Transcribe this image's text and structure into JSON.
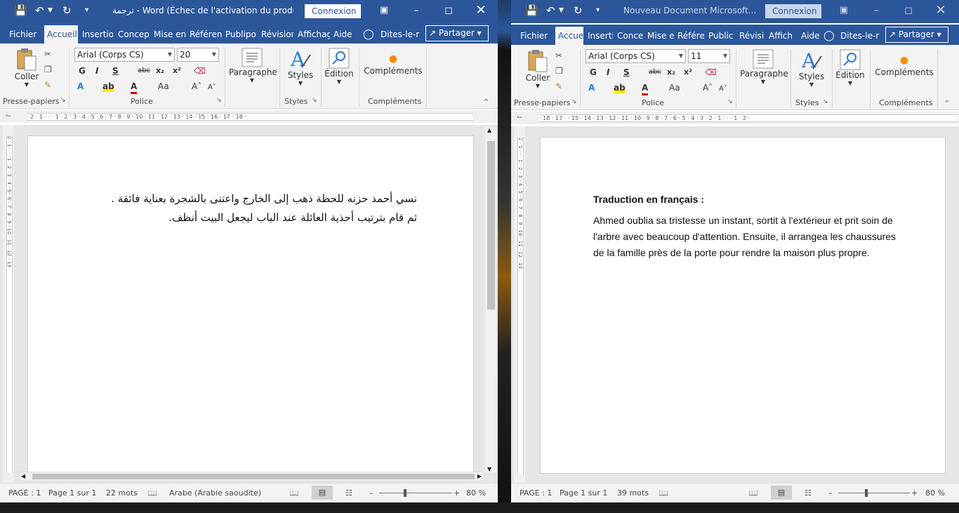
{
  "left_window": {
    "title": "ترجمة  -  Word (Échec de l'activation du produ...",
    "connexion": "Connexion",
    "tabs": [
      "Fichier",
      "Accueil",
      "Insertion",
      "Concep",
      "Mise en",
      "Référen",
      "Publipo",
      "Révisior",
      "Affichag",
      "Aide"
    ],
    "active_tab": "Accueil",
    "tell_me": "Dites-le-r",
    "share": "Partager",
    "font_name": "Arial (Corps CS)",
    "font_size": "20",
    "groups": {
      "clipboard": "Presse-papiers",
      "font": "Police",
      "styles": "Styles",
      "addins": "Compléments"
    },
    "buttons": {
      "paste": "Coller",
      "paragraph": "Paragraphe",
      "styles": "Styles",
      "edit": "Édition",
      "addins": "Compléments"
    },
    "ruler_text": "· 2 · 1 · · · 1 · 2 · 3 · 4 · 5 · 6 · 7 · 8 · 9 · 10 · 11 · 12 · 13 · 14 · 15 · 16 · 17 · 18 ·",
    "vruler_text": "2 · 1 · · · 1 · 2 · 3 · 4 · 5 · 6 · 7 · 8 · 9 · 10 · 11 · 12 · 13",
    "doc_lines": [
      "نسي أحمد حزنه للحظة ذهب إلى الخارج واعتنى بالشجرة بعناية فائقة .",
      "ثم قام بترتيب أحذية العائلة عند الباب ليجعل البيت أنظف."
    ],
    "status": {
      "page": "PAGE : 1",
      "pages": "Page 1 sur 1",
      "words": "22 mots",
      "language": "Arabe (Arabie saoudite)",
      "zoom": "80 %"
    }
  },
  "right_window": {
    "title": "Nouveau Document Microsoft...",
    "connexion": "Connexion",
    "tabs": [
      "Fichier",
      "Accue",
      "Inserti",
      "Conce",
      "Mise e",
      "Référe",
      "Public",
      "Révisi",
      "Affich",
      "Aide"
    ],
    "active_tab": "Accue",
    "tell_me": "Dites-le-r",
    "share": "Partager",
    "font_name": "Arial (Corps CS)",
    "font_size": "11",
    "groups": {
      "clipboard": "Presse-papiers",
      "font": "Police",
      "styles": "Styles",
      "addins": "Compléments"
    },
    "buttons": {
      "paste": "Coller",
      "paragraph": "Paragraphe",
      "styles": "Styles",
      "edit": "Édition",
      "addins": "Compléments"
    },
    "ruler_text": "· 18 · 17 · · 15 · 14 · 13 · 12 · 11 · 10 · 9 · 8 · 7 · 6 · 5 · 4 · 3 · 2 · 1 · · · 1 · 2 ·",
    "vruler_text": "2 · 1 · · · 1 · 2 · 3 · 4 · 5 · 6 · 7 · 8 · 9 · 10 · 11 · 12 · 13",
    "doc_heading": "Traduction en français :",
    "doc_lines": [
      "Ahmed oublia sa tristesse un instant, sortit à l'extérieur et prit soin de",
      "l'arbre avec beaucoup d'attention. Ensuite, il arrangea les chaussures",
      "de la famille près de la porte pour rendre la maison plus propre."
    ],
    "status": {
      "page": "PAGE : 1",
      "pages": "Page 1 sur 1",
      "words": "39 mots",
      "zoom": "80 %"
    }
  },
  "colors": {
    "word_blue": "#2b579a",
    "ribbon_bg": "#f3f3f3",
    "doc_bg": "#e6e6e6"
  },
  "icons": {
    "save": "save-icon",
    "undo": "undo-icon",
    "redo": "redo-icon",
    "customize": "customize-qat-icon",
    "restore": "ribbon-display-icon",
    "minimize": "minimize-icon",
    "maximize": "maximize-icon",
    "close": "close-icon",
    "bulb": "lightbulb-icon"
  }
}
